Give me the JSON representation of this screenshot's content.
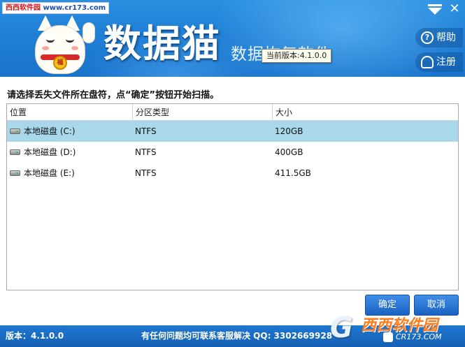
{
  "watermark_top": {
    "prefix": "西西软件园",
    "url": "www.cr173.com"
  },
  "header": {
    "title": "数据猫",
    "subtitle": "数据恢复软件",
    "version_tooltip": "当前版本:4.1.0.0",
    "bell_text": "福",
    "help_label": "帮助",
    "register_label": "注册"
  },
  "instruction": "请选择丢失文件所在盘符，点“确定”按钮开始扫描。",
  "table": {
    "columns": [
      "位置",
      "分区类型",
      "大小"
    ],
    "rows": [
      {
        "location": "本地磁盘 (C:)",
        "type": "NTFS",
        "size": "120GB",
        "selected": true
      },
      {
        "location": "本地磁盘 (D:)",
        "type": "NTFS",
        "size": "400GB",
        "selected": false
      },
      {
        "location": "本地磁盘 (E:)",
        "type": "NTFS",
        "size": "411.5GB",
        "selected": false
      }
    ]
  },
  "buttons": {
    "ok": "确定",
    "cancel": "取消"
  },
  "footer": {
    "version": "版本：4.1.0.0",
    "contact": "有任何问题均可联系客服解决  QQ: 3302669928"
  },
  "watermark_bottom": {
    "logo": "G",
    "name": "西西软件园",
    "url": "CR173.COM"
  },
  "colors": {
    "header_blue": "#1f7fd6",
    "selected_row": "#a9d8ea",
    "button_blue": "#1b62c2",
    "footer_blue": "#1a6cc4"
  }
}
